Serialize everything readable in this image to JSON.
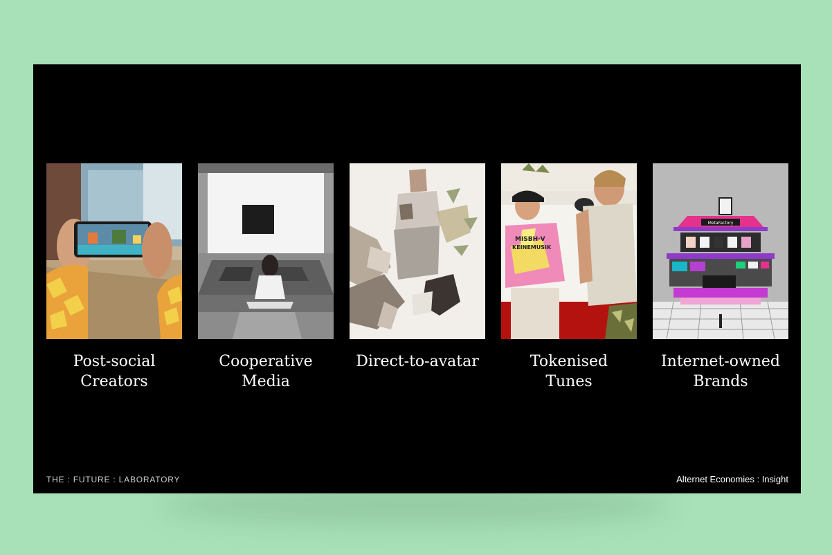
{
  "cards": [
    {
      "line1": "Post-social",
      "line2": "Creators",
      "image": "phone-game-photo"
    },
    {
      "line1": "Cooperative",
      "line2": "Media",
      "image": "gallery-viewer-photo"
    },
    {
      "line1": "Direct-to-avatar",
      "line2": "",
      "image": "shattered-avatar-render"
    },
    {
      "line1": "Tokenised",
      "line2": "Tunes",
      "image": "avatars-musicians-render",
      "shirt_text_1": "MISBH·V",
      "shirt_text_2": "KEINEMUSIK"
    },
    {
      "line1": "Internet-owned",
      "line2": "Brands",
      "image": "metafactory-store-render",
      "sign_text": "MetaFactory"
    }
  ],
  "footer": {
    "left": "THE : FUTURE : LABORATORY",
    "right": "Alternet Economies : Insight"
  }
}
